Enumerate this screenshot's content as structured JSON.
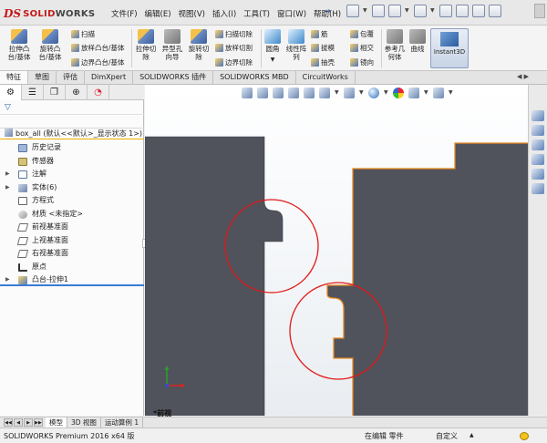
{
  "app": {
    "logo_mark": "DS",
    "logo_text_1": "SOLID",
    "logo_text_2": "WORKS",
    "menu": [
      "文件(F)",
      "编辑(E)",
      "视图(V)",
      "插入(I)",
      "工具(T)",
      "窗口(W)",
      "帮助(H)"
    ]
  },
  "ribbon": {
    "extrude_boss": "拉伸凸\n台/基体",
    "revolve_boss": "旋转凸\n台/基体",
    "sweep": "扫描",
    "loft_boss": "放样凸台/基体",
    "boundary_boss": "边界凸台/基体",
    "extrude_cut": "拉伸切\n除",
    "hole_wizard": "异型孔\n向导",
    "revolve_cut": "旋转切\n除",
    "swept_cut": "扫描切除",
    "lofted_cut": "放样切割",
    "boundary_cut": "边界切除",
    "fillet": "圆角",
    "linear_pattern": "线性阵\n列",
    "rib": "筋",
    "draft": "拔模",
    "shell": "抽壳",
    "wrap": "包覆",
    "intersect": "相交",
    "mirror": "镜向",
    "ref_geometry": "参考几\n何体",
    "curves": "曲线",
    "instant3d": "Instant3D"
  },
  "command_tabs": [
    "特征",
    "草图",
    "评估",
    "DimXpert",
    "SOLIDWORKS 插件",
    "SOLIDWORKS MBD",
    "CircuitWorks"
  ],
  "feature_tree": {
    "root": "box_all  (默认<<默认>_显示状态 1>)",
    "items": [
      {
        "label": "历史记录",
        "icon": "history-icon",
        "expandable": false
      },
      {
        "label": "传感器",
        "icon": "sensor-icon",
        "expandable": false
      },
      {
        "label": "注解",
        "icon": "annotation-icon",
        "expandable": true
      },
      {
        "label": "实体(6)",
        "icon": "solid-bodies-icon",
        "expandable": true
      },
      {
        "label": "方程式",
        "icon": "equation-icon",
        "expandable": false
      },
      {
        "label": "材质 <未指定>",
        "icon": "material-icon",
        "expandable": false
      },
      {
        "label": "前视基准面",
        "icon": "plane-icon",
        "expandable": false
      },
      {
        "label": "上视基准面",
        "icon": "plane-icon",
        "expandable": false
      },
      {
        "label": "右视基准面",
        "icon": "plane-icon",
        "expandable": false
      },
      {
        "label": "原点",
        "icon": "origin-icon",
        "expandable": false
      },
      {
        "label": "凸台-拉伸1",
        "icon": "boss-extrude-icon",
        "expandable": true
      }
    ]
  },
  "viewport": {
    "view_name": "*前视",
    "part_color": "#50535c",
    "edge_highlight": "#e8871e",
    "circle_color": "#e21818"
  },
  "bottom_tabs": [
    "模型",
    "3D 视图",
    "运动算例 1"
  ],
  "status": {
    "product": "SOLIDWORKS Premium 2016 x64 版",
    "mode": "在编辑 零件",
    "units": "自定义"
  }
}
